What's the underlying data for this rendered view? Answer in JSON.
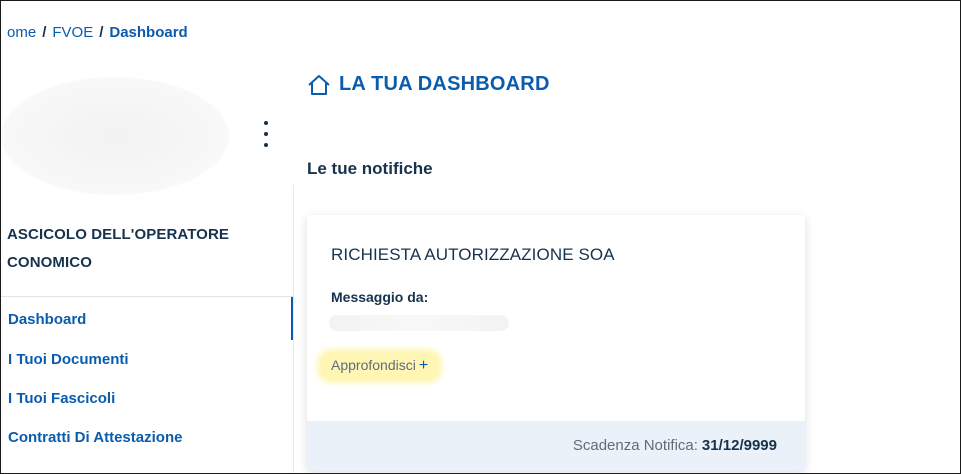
{
  "breadcrumb": {
    "items": [
      "ome",
      "FVOE"
    ],
    "separator": "/",
    "current": "Dashboard"
  },
  "sidebar": {
    "section_title": "ASCICOLO DELL'OPERATORE CONOMICO",
    "items": [
      {
        "label": "Dashboard",
        "active": true
      },
      {
        "label": "I Tuoi Documenti",
        "active": false
      },
      {
        "label": "I Tuoi Fascicoli",
        "active": false
      },
      {
        "label": "Contratti Di Attestazione",
        "active": false
      }
    ]
  },
  "main": {
    "title": "LA TUA DASHBOARD",
    "title_icon": "home-icon",
    "notifications_heading": "Le tue notifiche",
    "notification": {
      "title": "RICHIESTA AUTORIZZAZIONE SOA",
      "from_label": "Messaggio da:",
      "more_label": "Approfondisci",
      "more_icon": "plus-icon",
      "deadline_label": "Scadenza Notifica:",
      "deadline_value": "31/12/9999"
    }
  },
  "colors": {
    "link": "#0b5cad",
    "text_dark": "#17324d",
    "highlight": "#fff6b3",
    "footer_bg": "#eaf1f8"
  }
}
